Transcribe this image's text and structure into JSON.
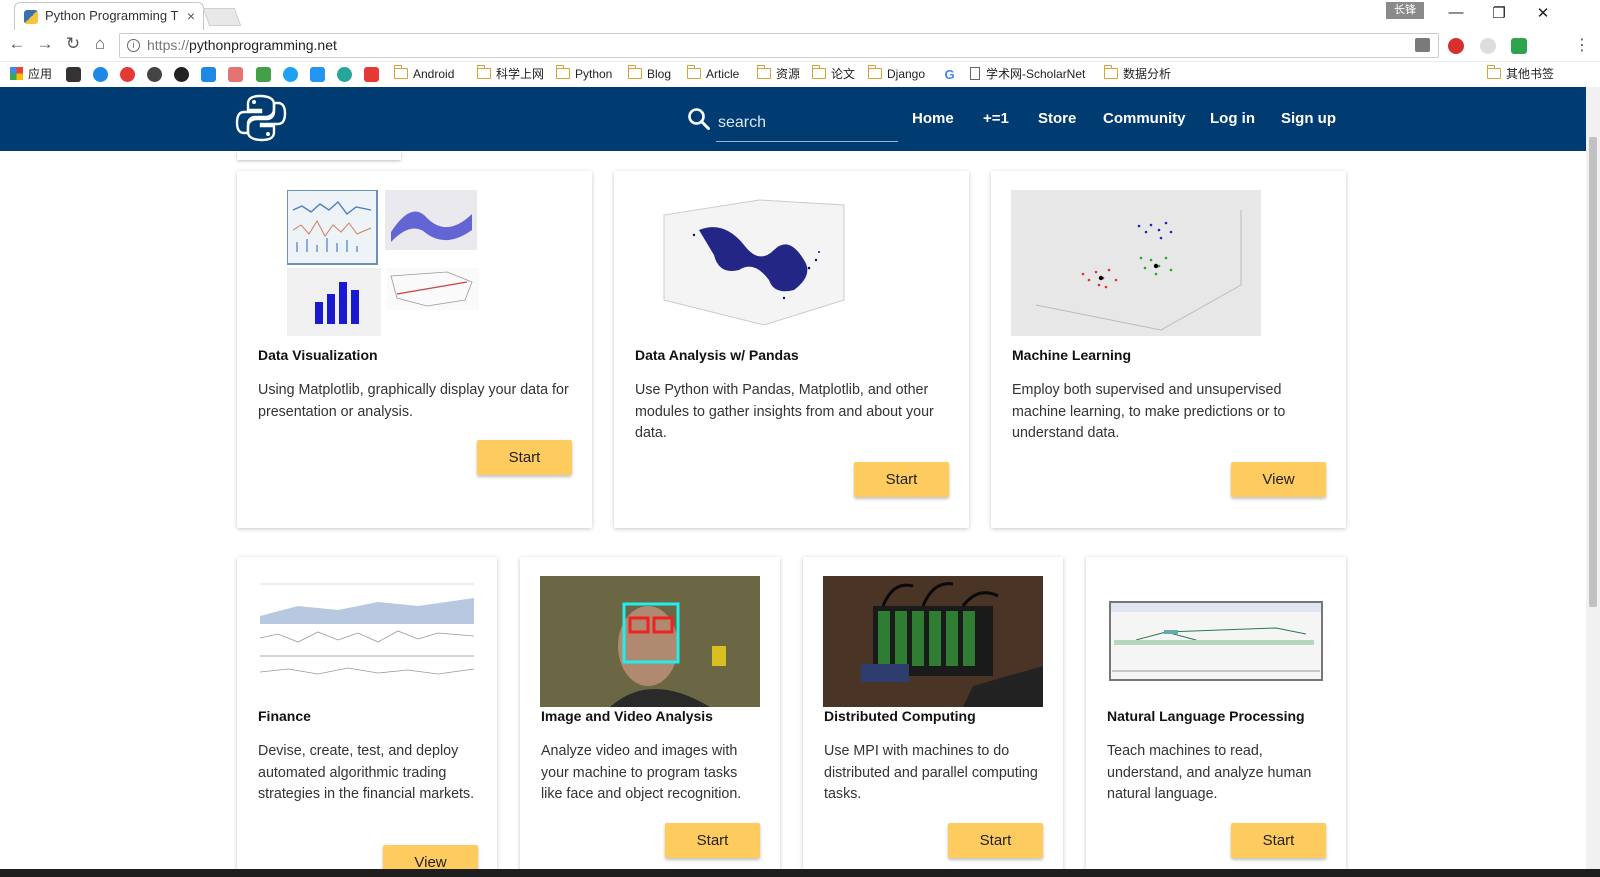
{
  "browser": {
    "tab_title": "Python Programming T",
    "tab_close": "×",
    "window_tag": "长锋",
    "window_buttons": [
      "—",
      "❐",
      "✕"
    ],
    "url_protocol": "https://",
    "url_host": "pythonprogramming.net",
    "nav_icons": [
      "back-icon",
      "forward-icon",
      "reload-icon",
      "home-icon"
    ]
  },
  "bookmarks": {
    "apps": "应用",
    "folders": [
      "Android",
      "科学上网",
      "Python",
      "Blog",
      "Article",
      "资源",
      "论文",
      "Django"
    ],
    "scholar": "学术网-ScholarNet",
    "data_analysis": "数据分析",
    "other": "其他书签"
  },
  "site": {
    "search_placeholder": "search",
    "nav": [
      "Home",
      "+=1",
      "Store",
      "Community",
      "Log in",
      "Sign up"
    ]
  },
  "cards": [
    {
      "title": "Data Visualization",
      "desc": "Using Matplotlib, graphically display your data for presentation or analysis.",
      "button": "Start"
    },
    {
      "title": "Data Analysis w/ Pandas",
      "desc": "Use Python with Pandas, Matplotlib, and other modules to gather insights from and about your data.",
      "button": "Start"
    },
    {
      "title": "Machine Learning",
      "desc": "Employ both supervised and unsupervised machine learning, to make predictions or to understand data.",
      "button": "View"
    },
    {
      "title": "Finance",
      "desc": "Devise, create, test, and deploy automated algorithmic trading strategies in the financial markets.",
      "button": "View"
    },
    {
      "title": "Image and Video Analysis",
      "desc": "Analyze video and images with your machine to program tasks like face and object recognition.",
      "button": "Start"
    },
    {
      "title": "Distributed Computing",
      "desc": "Use MPI with machines to do distributed and parallel computing tasks.",
      "button": "Start"
    },
    {
      "title": "Natural Language Processing",
      "desc": "Teach machines to read, understand, and analyze human natural language.",
      "button": "Start"
    }
  ],
  "colors": {
    "navbar": "#003c71",
    "button": "#fecb5f"
  }
}
